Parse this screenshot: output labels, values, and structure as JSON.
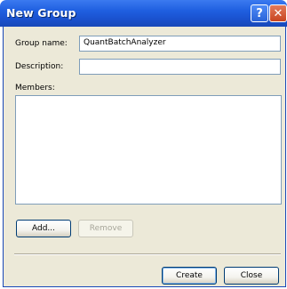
{
  "window": {
    "title": "New Group",
    "help_glyph": "?",
    "close_glyph": "✕"
  },
  "form": {
    "group_name_label": "Group name:",
    "group_name_value": "QuantBatchAnalyzer",
    "description_label": "Description:",
    "description_value": "",
    "members_label": "Members:"
  },
  "buttons": {
    "add": "Add...",
    "remove": "Remove",
    "create": "Create",
    "close": "Close"
  }
}
